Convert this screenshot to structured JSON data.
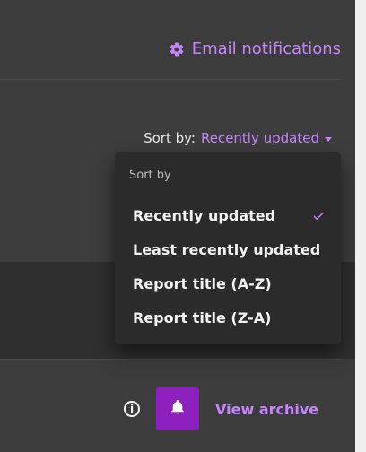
{
  "header": {
    "email_notifications_label": "Email notifications",
    "gear_icon": "gear-icon"
  },
  "sort": {
    "label": "Sort by:",
    "value": "Recently updated",
    "caret_icon": "chevron-down-icon",
    "dropdown": {
      "header": "Sort by",
      "items": [
        {
          "label": "Recently updated",
          "selected": true
        },
        {
          "label": "Least recently updated",
          "selected": false
        },
        {
          "label": "Report title (A-Z)",
          "selected": false
        },
        {
          "label": "Report title (Z-A)",
          "selected": false
        }
      ],
      "check_icon": "checkmark-icon"
    }
  },
  "footer": {
    "info_icon": "info-icon",
    "bell_icon": "bell-icon",
    "view_archive_label": "View archive"
  },
  "colors": {
    "accent": "#c884ff",
    "accent_strong": "#8e1fbf",
    "background": "#3d3d3d",
    "dropdown_bg": "#2b2b2b",
    "text": "#f2f2f2",
    "muted_text": "#bdbdbd"
  }
}
